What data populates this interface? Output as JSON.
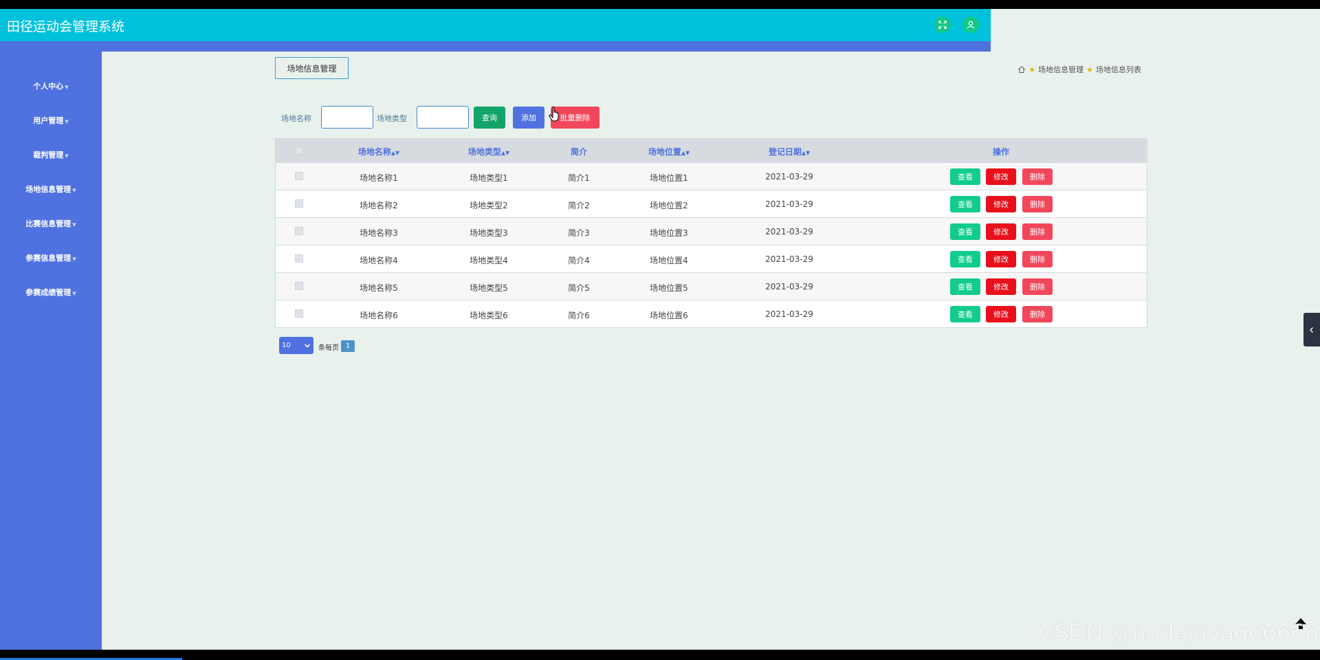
{
  "app": {
    "title": "田径运动会管理系统"
  },
  "sidebar": {
    "items": [
      {
        "label": "个人中心"
      },
      {
        "label": "用户管理"
      },
      {
        "label": "裁判管理"
      },
      {
        "label": "场地信息管理"
      },
      {
        "label": "比赛信息管理"
      },
      {
        "label": "参赛信息管理"
      },
      {
        "label": "参赛成绩管理"
      }
    ]
  },
  "page": {
    "tab_label": "场地信息管理"
  },
  "breadcrumb": {
    "items": [
      "场地信息管理",
      "场地信息列表"
    ]
  },
  "search": {
    "name_label": "场地名称",
    "type_label": "场地类型",
    "name_value": "",
    "type_value": "",
    "query_label": "查询",
    "add_label": "添加",
    "batch_delete_label": "批量删除"
  },
  "table": {
    "columns": [
      "场地名称",
      "场地类型",
      "简介",
      "场地位置",
      "登记日期",
      "操作"
    ],
    "rows": [
      [
        "场地名称1",
        "场地类型1",
        "简介1",
        "场地位置1",
        "2021-03-29"
      ],
      [
        "场地名称2",
        "场地类型2",
        "简介2",
        "场地位置2",
        "2021-03-29"
      ],
      [
        "场地名称3",
        "场地类型3",
        "简介3",
        "场地位置3",
        "2021-03-29"
      ],
      [
        "场地名称4",
        "场地类型4",
        "简介4",
        "场地位置4",
        "2021-03-29"
      ],
      [
        "场地名称5",
        "场地类型5",
        "简介5",
        "场地位置5",
        "2021-03-29"
      ],
      [
        "场地名称6",
        "场地类型6",
        "简介6",
        "场地位置6",
        "2021-03-29"
      ]
    ],
    "actions": {
      "view": "查看",
      "edit": "修改",
      "delete": "删除"
    }
  },
  "pager": {
    "page_size": "10",
    "per_page_label": "条每页",
    "current_page": "1"
  },
  "watermark": "CSDN @nodejava666666",
  "colors": {
    "header": "#00c1dc",
    "sidebar": "#4f72e0",
    "query": "#13a46a",
    "add": "#4f72e0",
    "batch_delete": "#f2475a",
    "view": "#12cc8b",
    "edit": "#e8101c",
    "delete": "#f2475a"
  }
}
